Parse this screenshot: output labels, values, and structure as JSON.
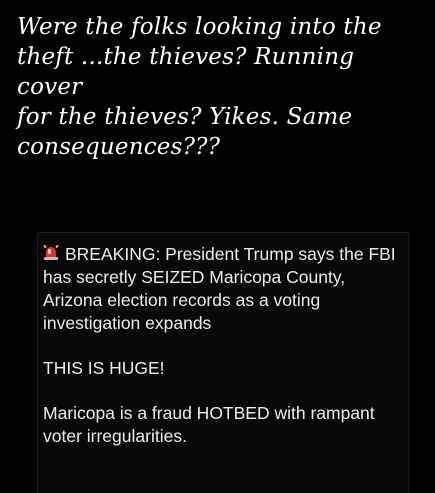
{
  "post": {
    "text": "Were the folks looking into the\ntheft ...the thieves? Running cover\nfor the thieves? Yikes. Same\nconsequences???"
  },
  "embedded": {
    "icon": "police-siren-icon",
    "paragraphs": [
      "BREAKING: President Trump says the FBI has secretly SEIZED Maricopa County, Arizona election records as a voting investigation expands",
      "THIS IS HUGE!",
      "Maricopa is a fraud HOTBED with rampant voter irregularities."
    ]
  },
  "colors": {
    "background": "#000000",
    "text": "#ffffff",
    "embed_background": "#080808",
    "siren": "#e2342e"
  }
}
